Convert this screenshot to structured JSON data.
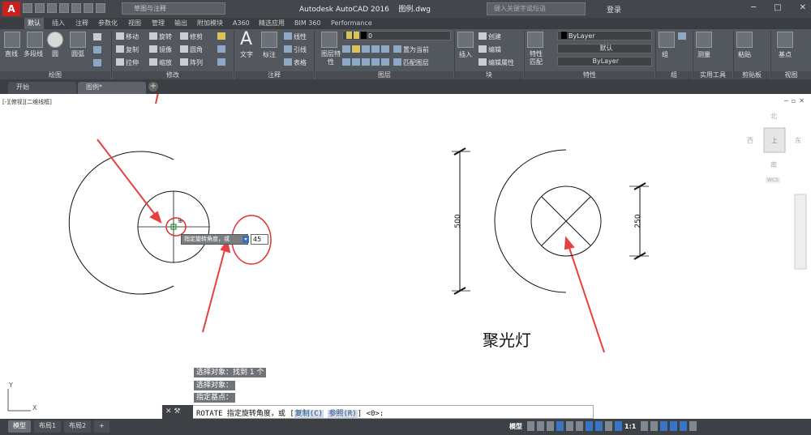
{
  "app": {
    "logo": "A",
    "title": "Autodesk AutoCAD 2016",
    "file": "图例.dwg",
    "workspace": "草图与注释",
    "search_placeholder": "键入关键字或短语",
    "login": "登录"
  },
  "ribbon_tabs": [
    "默认",
    "插入",
    "注释",
    "参数化",
    "视图",
    "管理",
    "输出",
    "附加模块",
    "A360",
    "精选应用",
    "BIM 360",
    "Performance"
  ],
  "panels": {
    "draw": {
      "title": "绘图",
      "items": [
        "直线",
        "多段线",
        "圆",
        "圆弧"
      ]
    },
    "modify": {
      "title": "修改",
      "items": [
        "移动",
        "旋转",
        "修剪",
        "复制",
        "镜像",
        "圆角",
        "拉伸",
        "缩放",
        "阵列"
      ]
    },
    "annotation": {
      "title": "注释",
      "items": [
        "文字",
        "标注",
        "线性",
        "引线",
        "表格"
      ]
    },
    "layers": {
      "title": "图层",
      "items": [
        "图层特性",
        "置为当前",
        "匹配图层"
      ],
      "current_layer": "0"
    },
    "block": {
      "title": "块",
      "items": [
        "插入",
        "创建",
        "编辑",
        "编辑属性"
      ]
    },
    "properties": {
      "title": "特性",
      "items": [
        "特性匹配"
      ],
      "color": "ByLayer",
      "linetype": "默认",
      "lineweight": "ByLayer"
    },
    "groups": {
      "title": "组",
      "items": [
        "组"
      ]
    },
    "utilities": {
      "title": "实用工具",
      "items": [
        "测量"
      ]
    },
    "clipboard": {
      "title": "剪贴板",
      "items": [
        "粘贴"
      ]
    },
    "view": {
      "title": "视图",
      "items": [
        "基点"
      ]
    }
  },
  "doc_tabs": [
    "开始",
    "图例*"
  ],
  "viewport_label": "[-][俯视][二维线框]",
  "viewcube": {
    "north": "北",
    "south": "南",
    "east": "东",
    "west": "西",
    "center": "上",
    "wcs": "WCS"
  },
  "drawing": {
    "dim_left": "500",
    "dim_right": "250",
    "caption": "聚光灯"
  },
  "rotate_tooltip": {
    "prompt": "指定旋转角度，或",
    "value": "45"
  },
  "command_history": [
    "选择对象：找到 1 个",
    "选择对象：",
    "指定基点："
  ],
  "command_line": {
    "prefix": "ROTATE 指定旋转角度，或 [",
    "opt1": "复制(C)",
    "opt2": "参照(R)",
    "suffix": "] <0>:"
  },
  "layout_tabs": [
    "模型",
    "布局1",
    "布局2"
  ],
  "status": {
    "model": "模型",
    "scale": "1:1"
  }
}
